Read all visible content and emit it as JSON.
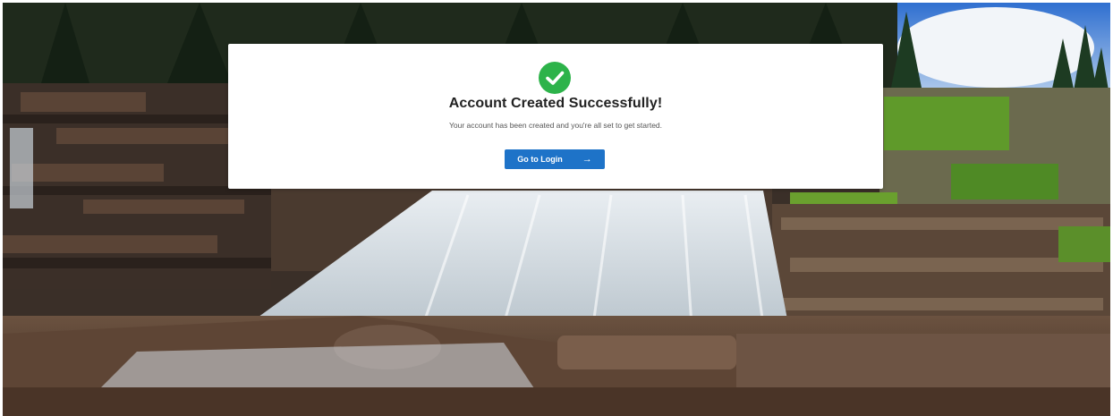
{
  "background": {
    "icon": "waterfall-landscape-photo"
  },
  "modal": {
    "icon": "success-check-icon",
    "title": "Account Created Successfully!",
    "message": "Your account has been created and you're all set to get started.",
    "button_label": "Go to Login",
    "button_icon": "arrow-right-icon"
  },
  "colors": {
    "success_green": "#2db34a",
    "button_blue": "#1e73c8"
  }
}
